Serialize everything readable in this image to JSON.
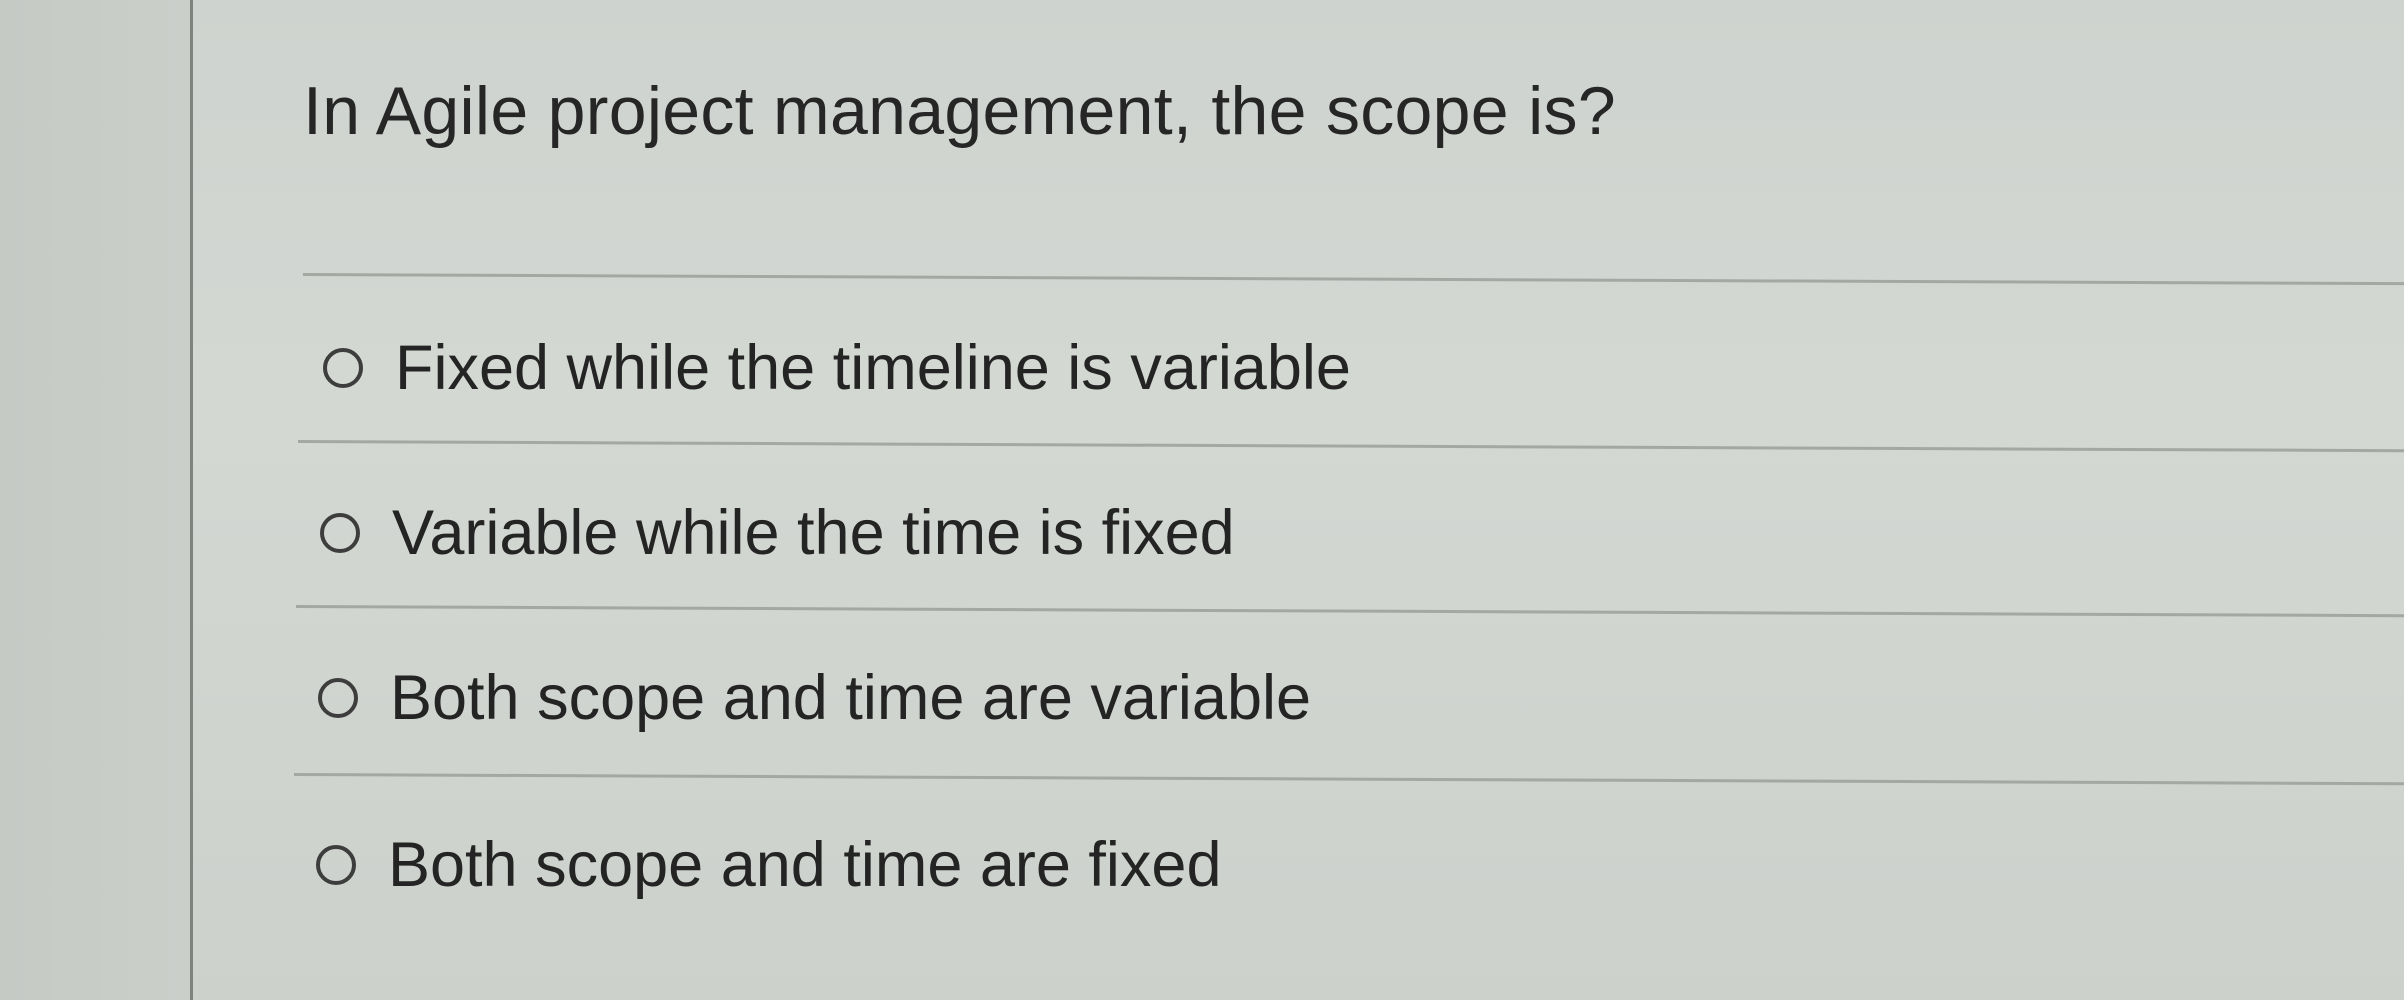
{
  "question": {
    "text": "In Agile project management, the scope is?"
  },
  "options": [
    {
      "label": "Fixed while the timeline is variable",
      "selected": false
    },
    {
      "label": "Variable while the time is fixed",
      "selected": false
    },
    {
      "label": "Both scope and time are variable",
      "selected": false
    },
    {
      "label": "Both scope and time are fixed",
      "selected": false
    }
  ]
}
